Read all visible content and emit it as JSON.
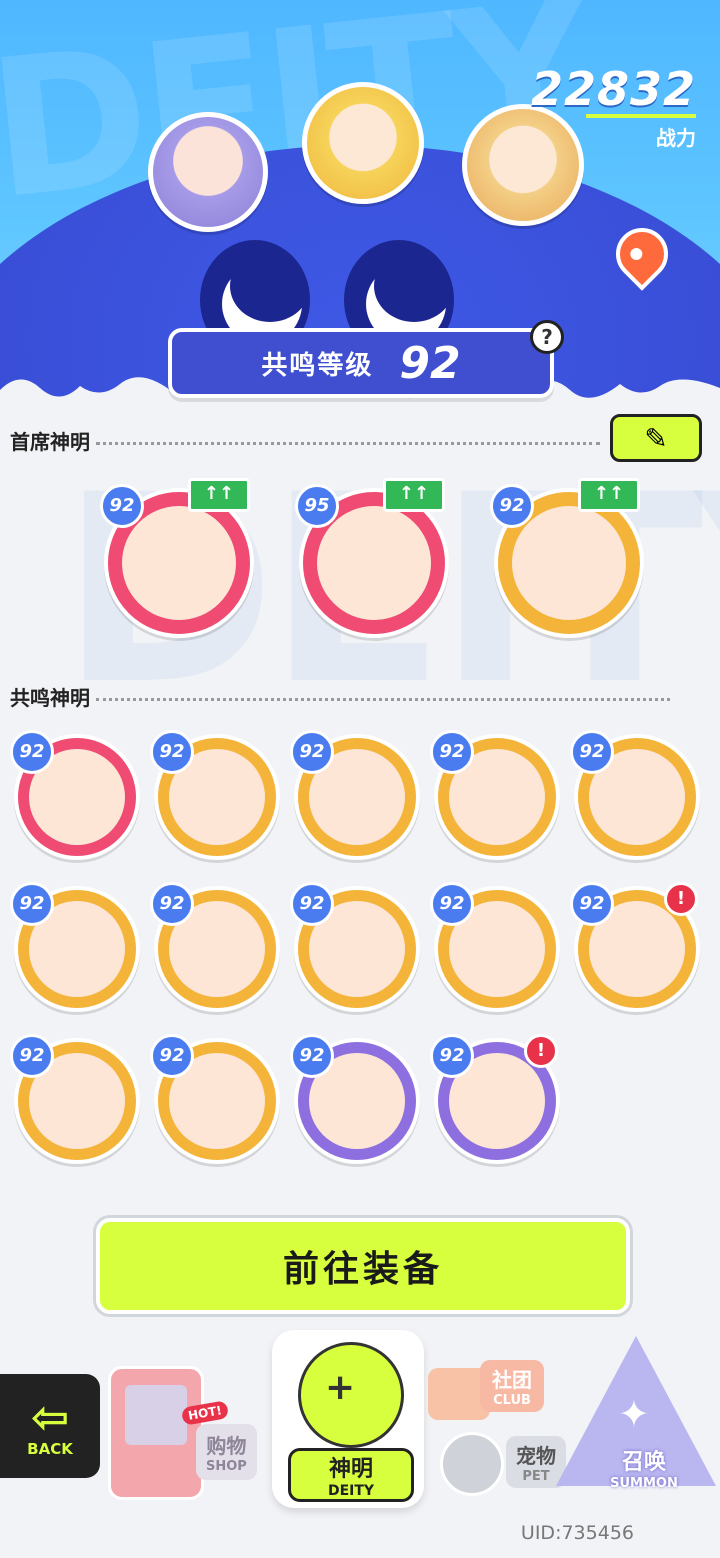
{
  "header": {
    "power_value": "22832",
    "power_label": "战力",
    "bg_text": "DEITY"
  },
  "resonance": {
    "label": "共鸣等级",
    "level": "92",
    "help": "?"
  },
  "head_section": {
    "title": "首席神明",
    "edit_icon": "pencil-icon",
    "deities": [
      {
        "level": "92",
        "color": "#ef4b73",
        "upgrade": "↑↑"
      },
      {
        "level": "95",
        "color": "#ef4b73",
        "upgrade": "↑↑"
      },
      {
        "level": "92",
        "color": "#f4b43a",
        "upgrade": "↑↑"
      }
    ]
  },
  "resonance_section": {
    "title": "共鸣神明",
    "deities": [
      {
        "level": "92",
        "color": "#ef4b73",
        "alert": ""
      },
      {
        "level": "92",
        "color": "#f4b43a",
        "alert": ""
      },
      {
        "level": "92",
        "color": "#f4b43a",
        "alert": ""
      },
      {
        "level": "92",
        "color": "#f4b43a",
        "alert": ""
      },
      {
        "level": "92",
        "color": "#f4b43a",
        "alert": ""
      },
      {
        "level": "92",
        "color": "#f4b43a",
        "alert": ""
      },
      {
        "level": "92",
        "color": "#f4b43a",
        "alert": ""
      },
      {
        "level": "92",
        "color": "#f4b43a",
        "alert": ""
      },
      {
        "level": "92",
        "color": "#f4b43a",
        "alert": ""
      },
      {
        "level": "92",
        "color": "#f4b43a",
        "alert": "!"
      },
      {
        "level": "92",
        "color": "#f4b43a",
        "alert": ""
      },
      {
        "level": "92",
        "color": "#f4b43a",
        "alert": ""
      },
      {
        "level": "92",
        "color": "#8e6fe0",
        "alert": ""
      },
      {
        "level": "92",
        "color": "#8e6fe0",
        "alert": "!"
      }
    ]
  },
  "go_button": "前往装备",
  "nav": {
    "back": "BACK",
    "shop_zh": "购物",
    "shop_en": "SHOP",
    "shop_hot": "HOT!",
    "deity_zh": "神明",
    "deity_en": "DEITY",
    "club_zh": "社团",
    "club_en": "CLUB",
    "pet_zh": "宠物",
    "pet_en": "PET",
    "summon_zh": "召唤",
    "summon_en": "SUMMON"
  },
  "uid": "UID:735456",
  "colors": {
    "accent": "#d8ff3d",
    "planet": "#3a4fd8",
    "sky": "#5fc6ff"
  }
}
